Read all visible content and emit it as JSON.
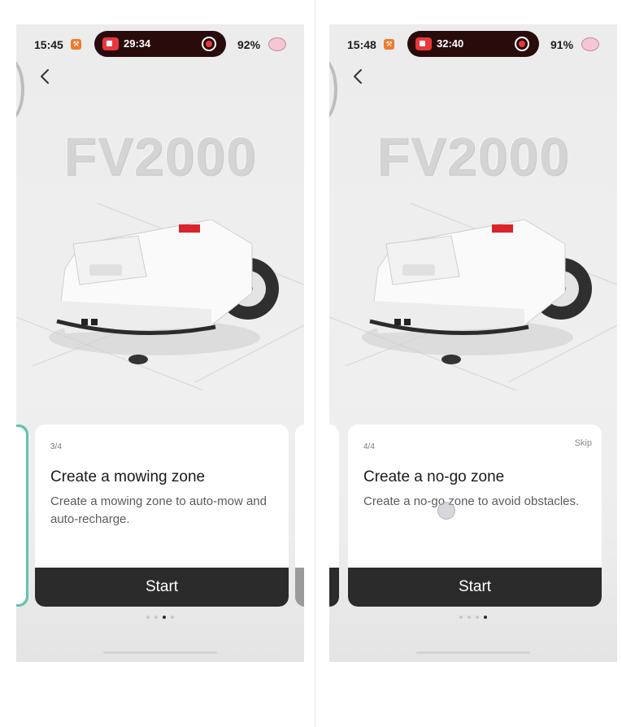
{
  "screens": [
    {
      "status": {
        "time": "15:45",
        "record_time": "29:34",
        "battery": "92%"
      },
      "model_name": "FV2000",
      "card": {
        "step": "3/4",
        "title": "Create a mowing zone",
        "description": "Create a mowing zone to auto-mow and auto-recharge.",
        "start_label": "Start"
      },
      "pager": {
        "total": 4,
        "active_index": 2
      }
    },
    {
      "status": {
        "time": "15:48",
        "record_time": "32:40",
        "battery": "91%"
      },
      "model_name": "FV2000",
      "card": {
        "step": "4/4",
        "skip_label": "Skip",
        "title": "Create a no-go zone",
        "description": "Create a no-go zone to avoid obstacles.",
        "start_label": "Start"
      },
      "pager": {
        "total": 4,
        "active_index": 3
      }
    }
  ],
  "colors": {
    "accent_teal": "#63c4ad",
    "button_dark": "#2b2b2b",
    "record_red": "#e8383b",
    "app_icon_orange": "#f07a2c"
  },
  "icons": [
    "back-arrow-icon",
    "screen-record-icon",
    "stop-record-icon",
    "app-badge-icon",
    "brain-icon"
  ]
}
